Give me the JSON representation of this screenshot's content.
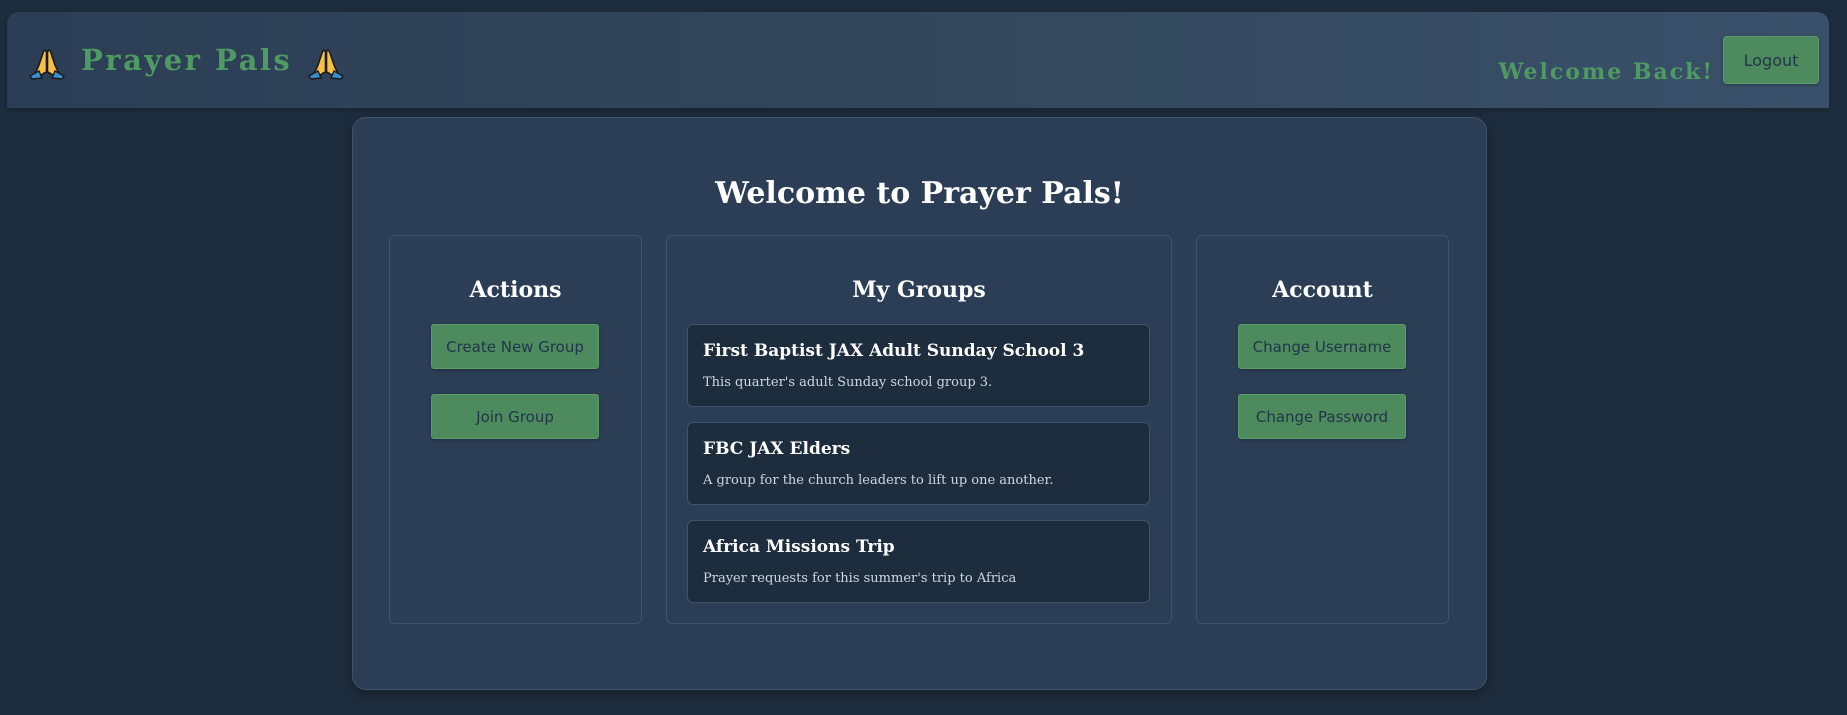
{
  "header": {
    "brand_title": "Prayer Pals",
    "brand_icon": "praying-hands-icon",
    "welcome_text": "Welcome Back!",
    "logout_label": "Logout"
  },
  "main": {
    "title": "Welcome to Prayer Pals!",
    "actions": {
      "heading": "Actions",
      "buttons": [
        "Create New Group",
        "Join Group"
      ]
    },
    "groups": {
      "heading": "My Groups",
      "items": [
        {
          "name": "First Baptist JAX Adult Sunday School 3",
          "description": "This quarter's adult Sunday school group 3."
        },
        {
          "name": "FBC JAX Elders",
          "description": "A group for the church leaders to lift up one another."
        },
        {
          "name": "Africa Missions Trip",
          "description": "Prayer requests for this summer's trip to Africa"
        }
      ]
    },
    "account": {
      "heading": "Account",
      "buttons": [
        "Change Username",
        "Change Password"
      ]
    }
  },
  "colors": {
    "background": "#1e2d3d",
    "panel": "#2c3e55",
    "accent_green": "#4e9a62",
    "button_green": "#4d8a5e",
    "button_text": "#22364a"
  }
}
